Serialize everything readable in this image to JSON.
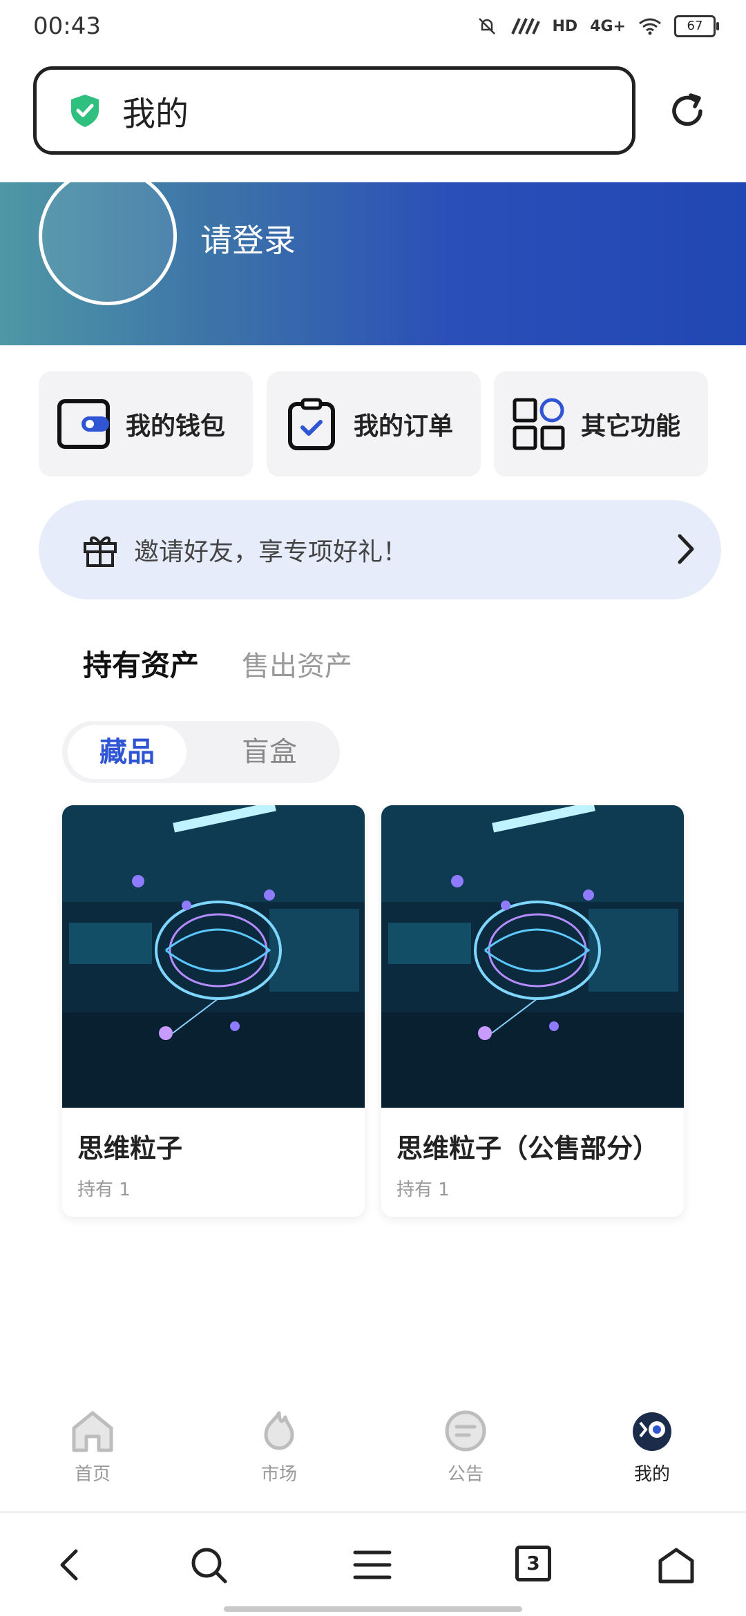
{
  "status": {
    "time": "00:43",
    "network": "4G+",
    "hd": "HD",
    "battery": "67"
  },
  "addressbar": {
    "title": "我的"
  },
  "profile": {
    "login_prompt": "请登录"
  },
  "quick_actions": [
    {
      "label": "我的钱包",
      "icon": "wallet-icon"
    },
    {
      "label": "我的订单",
      "icon": "order-clipboard-icon"
    },
    {
      "label": "其它功能",
      "icon": "apps-grid-icon"
    }
  ],
  "invite": {
    "text": "邀请好友，享专项好礼！"
  },
  "asset_tabs": {
    "active": "持有资产",
    "inactive": "售出资产"
  },
  "category_toggle": {
    "active": "藏品",
    "inactive": "盲盒"
  },
  "items": [
    {
      "title": "思维粒子",
      "holding": "持有 1"
    },
    {
      "title": "思维粒子（公售部分）",
      "holding": "持有 1"
    }
  ],
  "bottom_nav": [
    {
      "label": "首页",
      "icon": "home-icon"
    },
    {
      "label": "市场",
      "icon": "market-icon"
    },
    {
      "label": "公告",
      "icon": "announcement-icon"
    },
    {
      "label": "我的",
      "icon": "profile-icon"
    }
  ],
  "browser": {
    "tab_count": "3"
  },
  "colors": {
    "accent": "#2f55d4",
    "banner_start": "#4f97a6",
    "banner_end": "#2147b4",
    "invite_bg": "#e7ecfb"
  }
}
